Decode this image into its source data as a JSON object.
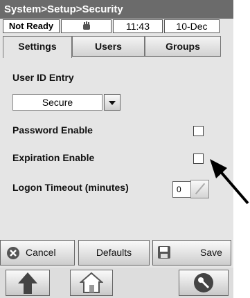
{
  "title": "System>Setup>Security",
  "status": {
    "state": "Not Ready",
    "time": "11:43",
    "date": "10-Dec",
    "icon": "hand-icon"
  },
  "tabs": [
    {
      "label": "Settings",
      "active": true
    },
    {
      "label": "Users"
    },
    {
      "label": "Groups"
    }
  ],
  "settings": {
    "user_id_label": "User ID Entry",
    "user_id_value": "Secure",
    "password_label": "Password Enable",
    "password_checked": false,
    "expiration_label": "Expiration Enable",
    "expiration_checked": false,
    "timeout_label": "Logon Timeout (minutes)",
    "timeout_value": "0"
  },
  "actions": {
    "cancel": "Cancel",
    "defaults": "Defaults",
    "save": "Save"
  },
  "nav": {
    "up_icon": "up-arrow-icon",
    "home_icon": "home-icon",
    "key_icon": "key-icon"
  },
  "colors": {
    "titlebar": "#6b6b6b",
    "panel": "#e5e5e5",
    "arrow": "#000000"
  }
}
